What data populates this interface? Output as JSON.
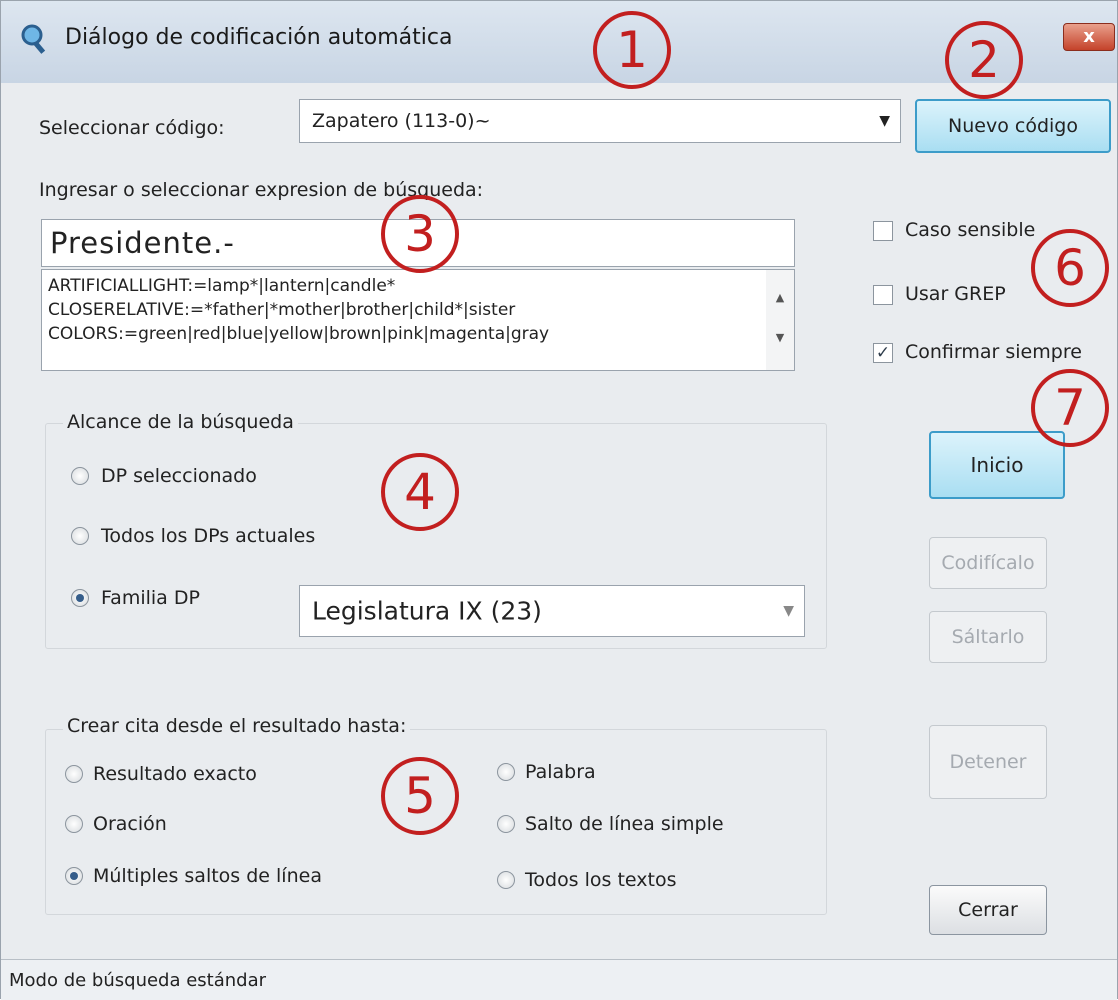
{
  "window": {
    "title": "Diálogo de codificación automática",
    "close_glyph": "x",
    "icon": "search-app-icon"
  },
  "select_code": {
    "label": "Seleccionar código:",
    "value": "Zapatero (113-0)~",
    "new_button": "Nuevo código"
  },
  "search": {
    "label": "Ingresar o seleccionar expresion de búsqueda:",
    "value": "Presidente.-",
    "expressions": [
      "ARTIFICIALLIGHT:=lamp*|lantern|candle*",
      "CLOSERELATIVE:=*father|*mother|brother|child*|sister",
      "COLORS:=green|red|blue|yellow|brown|pink|magenta|gray"
    ]
  },
  "options": {
    "case_sensitive": {
      "label": "Caso sensible",
      "checked": false
    },
    "use_grep": {
      "label": "Usar GREP",
      "checked": false
    },
    "confirm_always": {
      "label": "Confirmar siempre",
      "checked": true
    }
  },
  "scope": {
    "title": "Alcance de la búsqueda",
    "items": [
      {
        "label": "DP seleccionado",
        "selected": false
      },
      {
        "label": "Todos los DPs actuales",
        "selected": false
      },
      {
        "label": "Familia DP",
        "selected": true
      }
    ],
    "family_value": "Legislatura IX (23)"
  },
  "quote": {
    "title": "Crear cita desde el resultado hasta:",
    "left_items": [
      {
        "label": "Resultado exacto",
        "selected": false
      },
      {
        "label": "Oración",
        "selected": false
      },
      {
        "label": "Múltiples saltos de línea",
        "selected": true
      }
    ],
    "right_items": [
      {
        "label": "Palabra",
        "selected": false
      },
      {
        "label": "Salto de línea simple",
        "selected": false
      },
      {
        "label": "Todos los textos",
        "selected": false
      }
    ]
  },
  "buttons": {
    "start": "Inicio",
    "code_it": "Codifícalo",
    "skip": "Sáltarlo",
    "stop": "Detener",
    "close": "Cerrar"
  },
  "status": "Modo de búsqueda estándar",
  "annotations": [
    "1",
    "2",
    "3",
    "4",
    "5",
    "6",
    "7"
  ],
  "colors": {
    "annotation": "#c21f1f",
    "highlight_border": "#3c9cc9",
    "title_bar": "#c8d5e4"
  }
}
